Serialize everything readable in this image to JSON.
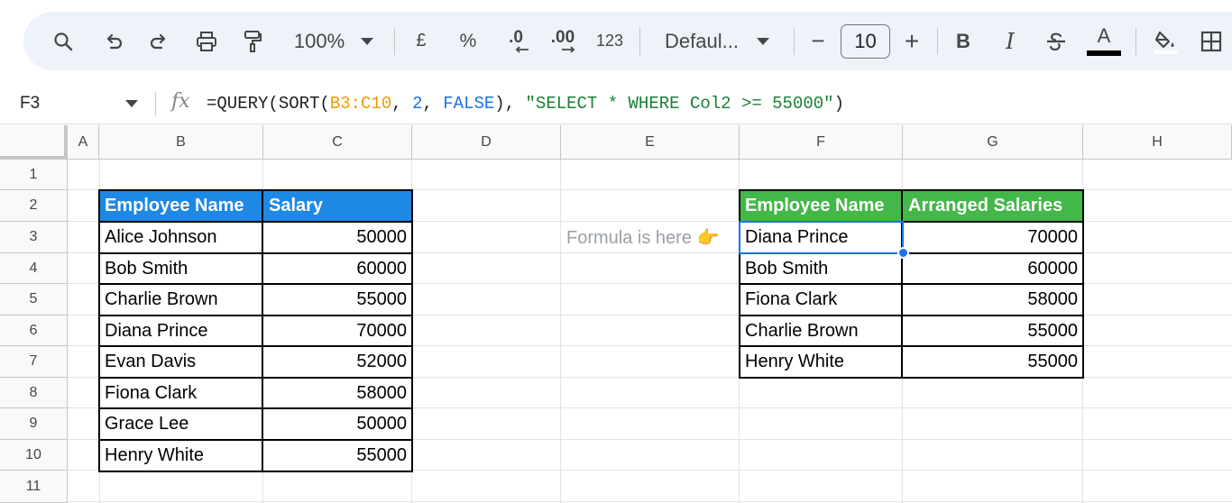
{
  "toolbar": {
    "zoom": "100%",
    "currency": "£",
    "percent": "%",
    "dec_decrease": ".0",
    "dec_increase": ".00",
    "more_formats": "123",
    "font": "Defaul...",
    "font_size": "10",
    "minus": "−",
    "plus": "+",
    "bold": "B",
    "italic": "I",
    "text_color_letter": "A",
    "text_color": "#000000"
  },
  "formula_bar": {
    "cell_ref": "F3",
    "fx": "fx",
    "formula": {
      "p1": "=QUERY(SORT(",
      "range": "B3:C10",
      "p2": ", ",
      "num": "2",
      "p3": ", ",
      "bool": "FALSE",
      "p4": "), ",
      "str": "\"SELECT * WHERE Col2 >= 55000\"",
      "p5": ")"
    }
  },
  "grid": {
    "columns": [
      "A",
      "B",
      "C",
      "D",
      "E",
      "F",
      "G",
      "H"
    ],
    "rows": [
      "1",
      "2",
      "3",
      "4",
      "5",
      "6",
      "7",
      "8",
      "9",
      "10",
      "11"
    ],
    "selected_cell": "F3"
  },
  "source_table": {
    "header": [
      "Employee Name",
      "Salary"
    ],
    "header_color": "#1e88e5",
    "rows": [
      [
        "Alice Johnson",
        "50000"
      ],
      [
        "Bob Smith",
        "60000"
      ],
      [
        "Charlie Brown",
        "55000"
      ],
      [
        "Diana Prince",
        "70000"
      ],
      [
        "Evan Davis",
        "52000"
      ],
      [
        "Fiona Clark",
        "58000"
      ],
      [
        "Grace Lee",
        "50000"
      ],
      [
        "Henry White",
        "55000"
      ]
    ]
  },
  "result_table": {
    "header": [
      "Employee Name",
      "Arranged Salaries"
    ],
    "header_color": "#43b748",
    "rows": [
      [
        "Diana Prince",
        "70000"
      ],
      [
        "Bob Smith",
        "60000"
      ],
      [
        "Fiona Clark",
        "58000"
      ],
      [
        "Charlie Brown",
        "55000"
      ],
      [
        "Henry White",
        "55000"
      ]
    ]
  },
  "note": "Formula is here 👉"
}
